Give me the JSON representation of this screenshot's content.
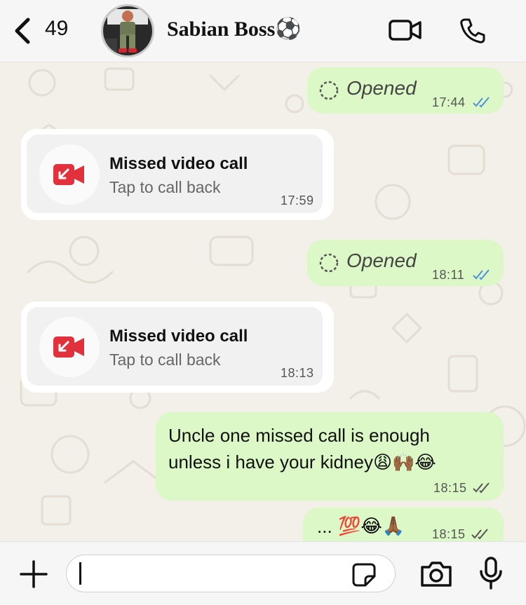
{
  "header": {
    "unread_count": "49",
    "contact_name": "Sabian Boss⚽",
    "icons": [
      "chevron-left-icon",
      "video-camera-icon",
      "phone-icon"
    ]
  },
  "messages": [
    {
      "type": "outgoing-opened",
      "text": "Opened",
      "time": "17:44",
      "status": "read"
    },
    {
      "type": "missed-call",
      "title": "Missed video call",
      "subtitle": "Tap to call back",
      "time": "17:59"
    },
    {
      "type": "outgoing-opened",
      "text": "Opened",
      "time": "18:11",
      "status": "read"
    },
    {
      "type": "missed-call",
      "title": "Missed video call",
      "subtitle": "Tap to call back",
      "time": "18:13"
    },
    {
      "type": "outgoing-text",
      "line1": "Uncle one missed call is enough",
      "line2": "unless i have your kidney",
      "emojis": "😩🙌🏾😂",
      "time": "18:15",
      "status": "delivered"
    },
    {
      "type": "outgoing-text",
      "text": "...",
      "emojis": "💯😂🙏🏾",
      "time": "18:15",
      "status": "delivered"
    }
  ],
  "input": {
    "placeholder": "",
    "icons": [
      "plus-icon",
      "sticker-icon",
      "camera-icon",
      "microphone-icon"
    ]
  },
  "colors": {
    "outgoing_bubble": "#dbf8c6",
    "incoming_bubble": "#ffffff",
    "missed_call_red": "#e0313d",
    "read_tick_blue": "#4f8fdc",
    "wallpaper": "#f3efe9"
  }
}
